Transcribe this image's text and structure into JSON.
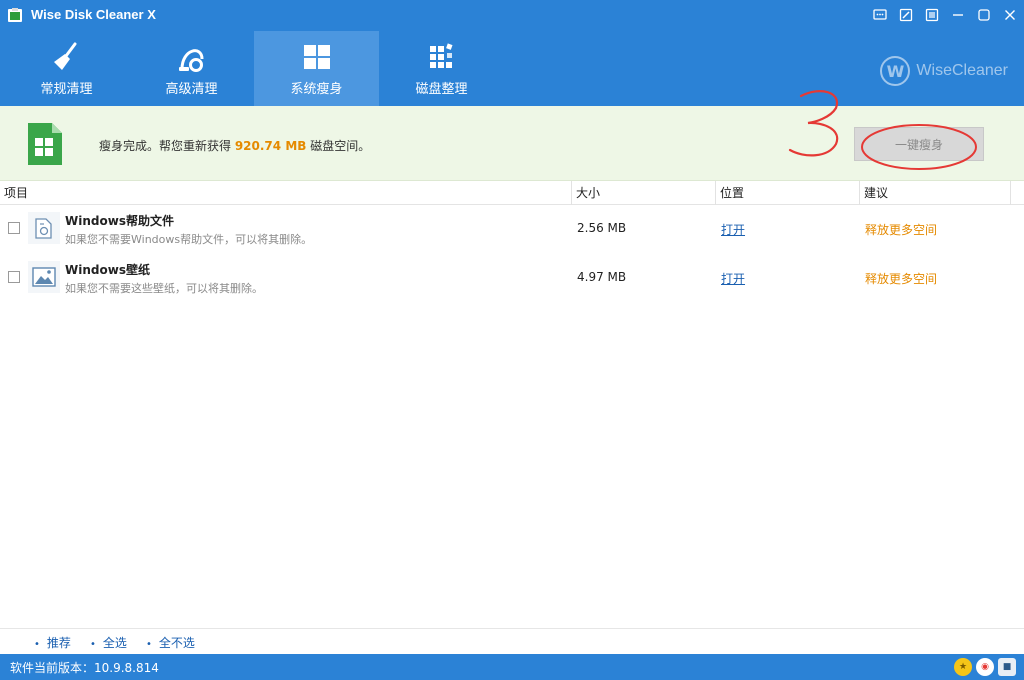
{
  "app": {
    "title": "Wise Disk Cleaner X"
  },
  "nav": {
    "tabs": [
      {
        "label": "常规清理",
        "icon": "broom-icon"
      },
      {
        "label": "高级清理",
        "icon": "vacuum-icon"
      },
      {
        "label": "系统瘦身",
        "icon": "windows-logo-icon",
        "active": true
      },
      {
        "label": "磁盘整理",
        "icon": "defrag-blocks-icon"
      }
    ]
  },
  "brand": {
    "logo": "W",
    "text": "WiseCleaner"
  },
  "banner": {
    "prefix": "瘦身完成。帮您重新获得 ",
    "amount": "920.74 MB",
    "suffix": " 磁盘空间。",
    "button": "一键瘦身",
    "annotation": "3"
  },
  "table": {
    "columns": [
      "项目",
      "大小",
      "位置",
      "建议"
    ],
    "rows": [
      {
        "title": "Windows帮助文件",
        "desc": "如果您不需要Windows帮助文件，可以将其删除。",
        "size": "2.56 MB",
        "location": "打开",
        "advice": "释放更多空间",
        "icon": "help-file-icon"
      },
      {
        "title": "Windows壁纸",
        "desc": "如果您不需要这些壁纸，可以将其删除。",
        "size": "4.97 MB",
        "location": "打开",
        "advice": "释放更多空间",
        "icon": "wallpaper-image-icon"
      }
    ]
  },
  "footer": {
    "links": [
      "推荐",
      "全选",
      "全不选"
    ]
  },
  "status": {
    "version": "软件当前版本：10.9.8.814"
  },
  "colors": {
    "header": "#2b82d6",
    "active_tab": "#4c97e0",
    "banner_bg": "#eef7e6",
    "highlight": "#e58a00",
    "link": "#1a5fb0"
  }
}
